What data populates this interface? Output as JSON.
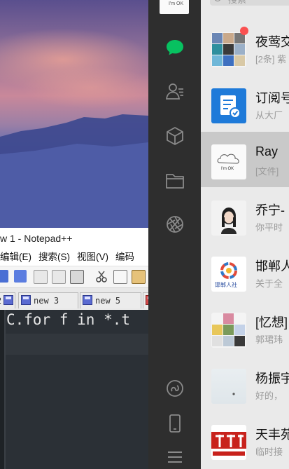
{
  "notepad": {
    "title": "w 1 - Notepad++",
    "menu": [
      "编辑(E)",
      "搜索(S)",
      "视图(V)",
      "编码"
    ],
    "tabs": [
      "2",
      "new 3",
      "new 5"
    ],
    "code_line": "C.for f in *.t"
  },
  "wechat": {
    "search_placeholder": "搜索",
    "avatar_text": "I'm OK",
    "chats": [
      {
        "name": "夜莺交",
        "msg": "[2条] 紫",
        "badge": true
      },
      {
        "name": "订阅号",
        "msg": "从大厂",
        "badge": false
      },
      {
        "name": "Ray",
        "msg": "[文件]",
        "badge": false,
        "avatar_text": "I'm OK"
      },
      {
        "name": "乔宁-",
        "msg": "你平时",
        "badge": false
      },
      {
        "name": "邯郸人",
        "msg": "关于全",
        "badge": false,
        "avatar_text": "邯郸人社"
      },
      {
        "name": "[忆想]",
        "msg": "郭珺玮",
        "badge": false
      },
      {
        "name": "杨振宇",
        "msg": "好的，",
        "badge": false
      },
      {
        "name": "天丰苑",
        "msg": "临时接",
        "badge": false
      }
    ]
  },
  "colors": {
    "wechat_green": "#07c160",
    "badge_red": "#fa5151",
    "sidebar_bg": "#2e2e2e"
  }
}
